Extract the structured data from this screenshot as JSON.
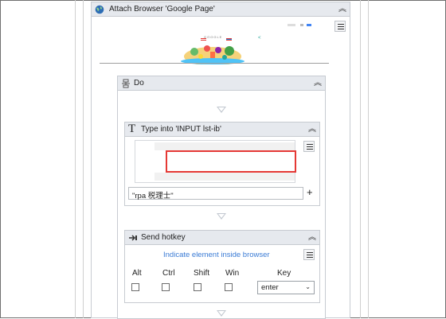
{
  "attach": {
    "title": "Attach Browser 'Google Page'",
    "thumbnail": {
      "logo_text": "GOOGLE"
    }
  },
  "do_block": {
    "title": "Do"
  },
  "type_into": {
    "title": "Type into 'INPUT  lst-ib'",
    "text_value": "\"rpa 税理士\"",
    "add_label": "+"
  },
  "hotkey": {
    "title": "Send hotkey",
    "indicate_link": "Indicate element inside browser",
    "labels": {
      "alt": "Alt",
      "ctrl": "Ctrl",
      "shift": "Shift",
      "win": "Win",
      "key": "Key"
    },
    "checks": {
      "alt": false,
      "ctrl": false,
      "shift": false,
      "win": false
    },
    "key_value": "enter"
  },
  "colors": {
    "header_bg": "#e6e9ee",
    "panel_border": "#c7cbd1",
    "link_blue": "#3a7bd5",
    "highlight_red": "#e53935"
  }
}
